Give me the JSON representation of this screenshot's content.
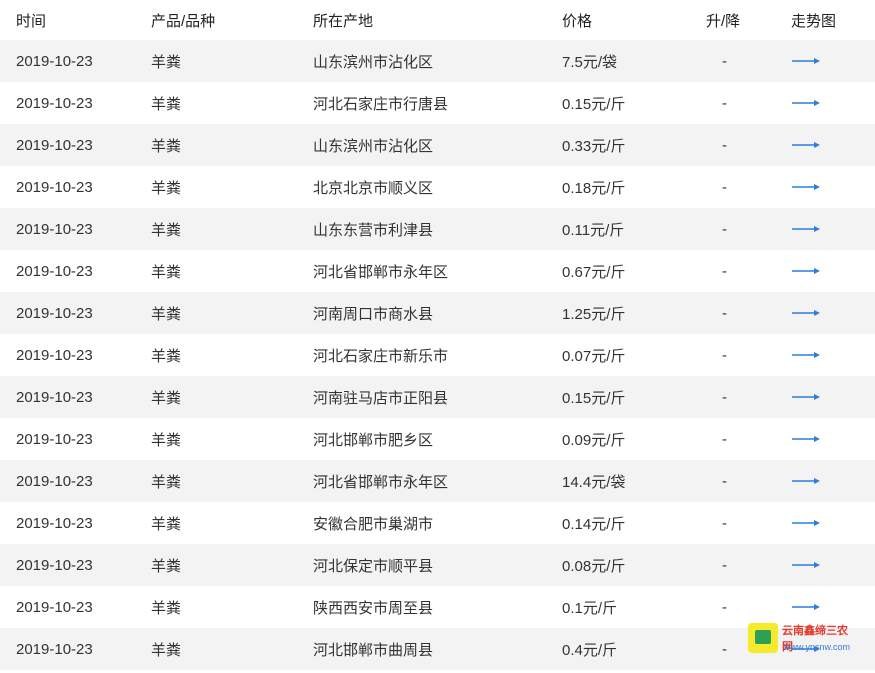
{
  "header": {
    "time": "时间",
    "product": "产品/品种",
    "origin": "所在产地",
    "price": "价格",
    "change": "升/降",
    "trend": "走势图"
  },
  "rows": [
    {
      "date": "2019-10-23",
      "product": "羊粪",
      "origin": "山东滨州市沾化区",
      "price": "7.5元/袋",
      "change": "-"
    },
    {
      "date": "2019-10-23",
      "product": "羊粪",
      "origin": "河北石家庄市行唐县",
      "price": "0.15元/斤",
      "change": "-"
    },
    {
      "date": "2019-10-23",
      "product": "羊粪",
      "origin": "山东滨州市沾化区",
      "price": "0.33元/斤",
      "change": "-"
    },
    {
      "date": "2019-10-23",
      "product": "羊粪",
      "origin": "北京北京市顺义区",
      "price": "0.18元/斤",
      "change": "-"
    },
    {
      "date": "2019-10-23",
      "product": "羊粪",
      "origin": "山东东营市利津县",
      "price": "0.11元/斤",
      "change": "-"
    },
    {
      "date": "2019-10-23",
      "product": "羊粪",
      "origin": "河北省邯郸市永年区",
      "price": "0.67元/斤",
      "change": "-"
    },
    {
      "date": "2019-10-23",
      "product": "羊粪",
      "origin": "河南周口市商水县",
      "price": "1.25元/斤",
      "change": "-"
    },
    {
      "date": "2019-10-23",
      "product": "羊粪",
      "origin": "河北石家庄市新乐市",
      "price": "0.07元/斤",
      "change": "-"
    },
    {
      "date": "2019-10-23",
      "product": "羊粪",
      "origin": "河南驻马店市正阳县",
      "price": "0.15元/斤",
      "change": "-"
    },
    {
      "date": "2019-10-23",
      "product": "羊粪",
      "origin": "河北邯郸市肥乡区",
      "price": "0.09元/斤",
      "change": "-"
    },
    {
      "date": "2019-10-23",
      "product": "羊粪",
      "origin": "河北省邯郸市永年区",
      "price": "14.4元/袋",
      "change": "-"
    },
    {
      "date": "2019-10-23",
      "product": "羊粪",
      "origin": "安徽合肥市巢湖市",
      "price": "0.14元/斤",
      "change": "-"
    },
    {
      "date": "2019-10-23",
      "product": "羊粪",
      "origin": "河北保定市顺平县",
      "price": "0.08元/斤",
      "change": "-"
    },
    {
      "date": "2019-10-23",
      "product": "羊粪",
      "origin": "陕西西安市周至县",
      "price": "0.1元/斤",
      "change": "-"
    },
    {
      "date": "2019-10-23",
      "product": "羊粪",
      "origin": "河北邯郸市曲周县",
      "price": "0.4元/斤",
      "change": "-"
    }
  ],
  "trend_icon": "arrow-right-icon",
  "colors": {
    "stripe": "#f3f3f3",
    "text": "#333333",
    "arrow": "#2b7de0"
  },
  "watermark": {
    "title": "云南鑫缔三农网",
    "url": "www.ynsnw.com"
  }
}
